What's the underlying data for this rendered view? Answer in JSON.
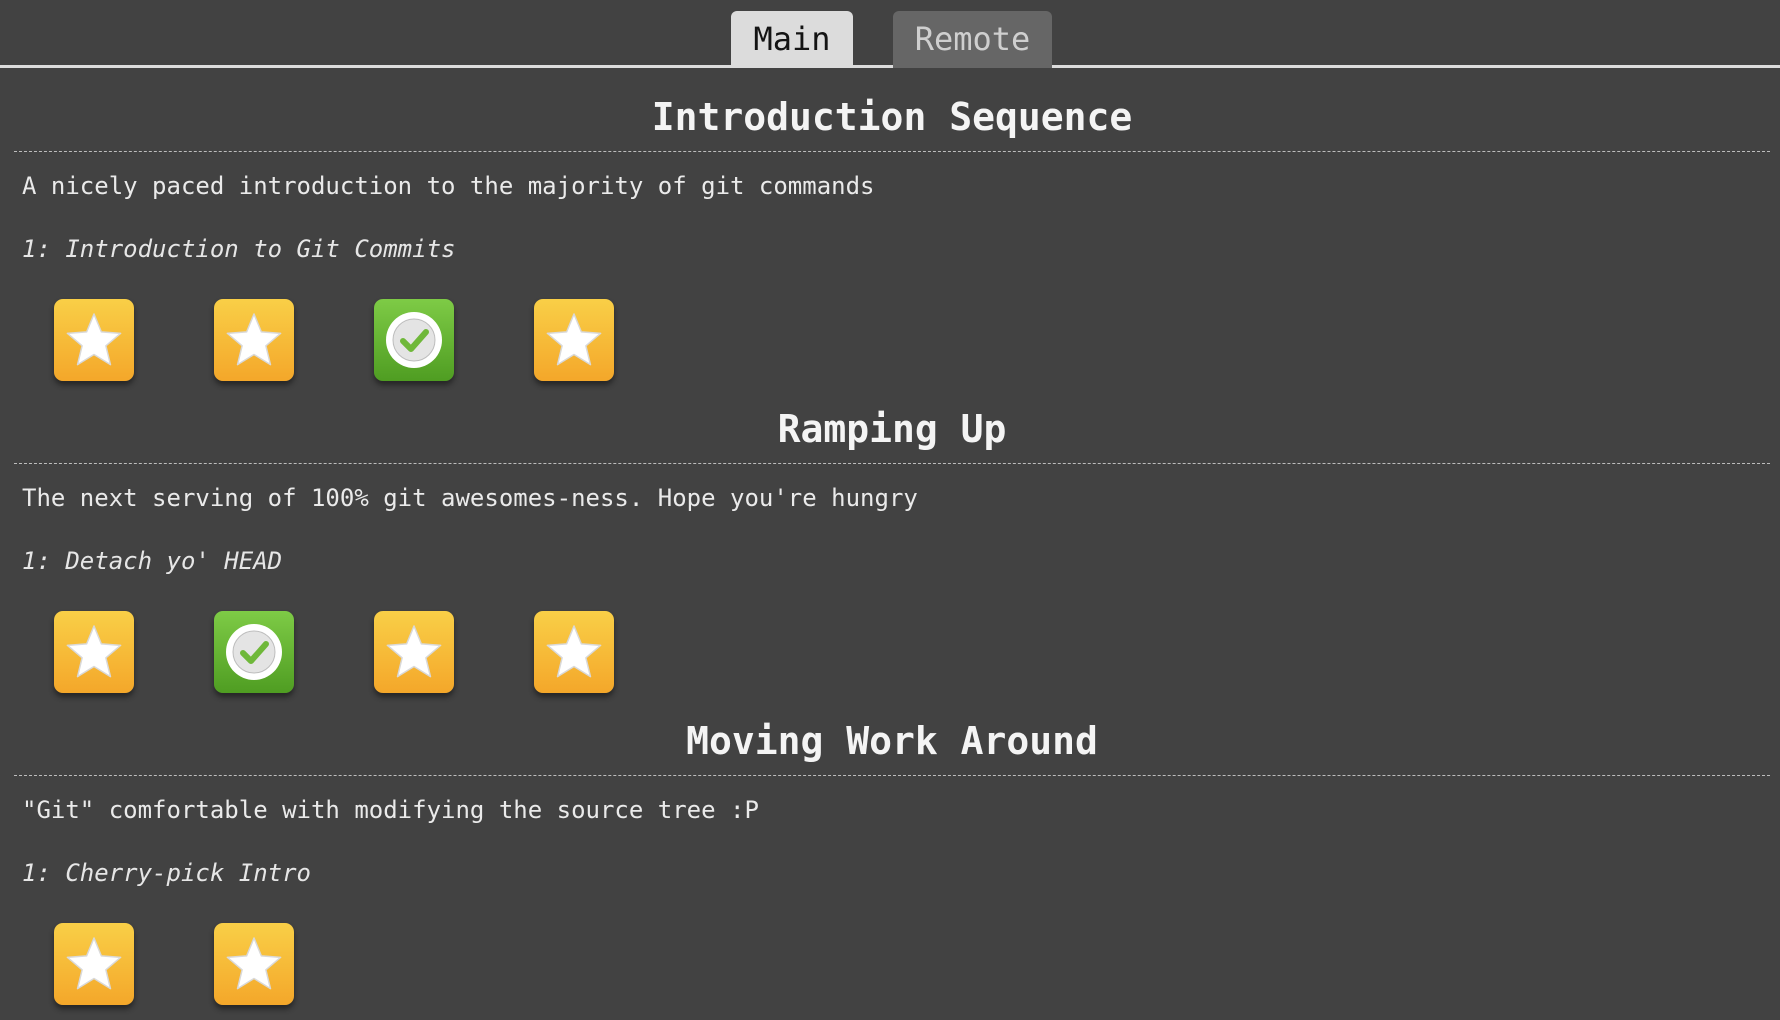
{
  "tabs": [
    {
      "label": "Main",
      "active": true
    },
    {
      "label": "Remote",
      "active": false
    }
  ],
  "sections": [
    {
      "title": "Introduction Sequence",
      "description": "A nicely paced introduction to the majority of git commands",
      "current_level": "1: Introduction to Git Commits",
      "levels": [
        "star-icon",
        "star-icon",
        "check-icon",
        "star-icon"
      ]
    },
    {
      "title": "Ramping Up",
      "description": "The next serving of 100% git awesomes-ness. Hope you're hungry",
      "current_level": "1: Detach yo' HEAD",
      "levels": [
        "star-icon",
        "check-icon",
        "star-icon",
        "star-icon"
      ]
    },
    {
      "title": "Moving Work Around",
      "description": "\"Git\" comfortable with modifying the source tree :P",
      "current_level": "1: Cherry-pick Intro",
      "levels": [
        "star-icon",
        "star-icon"
      ]
    }
  ],
  "colors": {
    "background": "#424242",
    "star_tile": "#f6b733",
    "check_tile": "#66b534",
    "active_tab": "#dcdcdc",
    "inactive_tab": "#666666"
  }
}
